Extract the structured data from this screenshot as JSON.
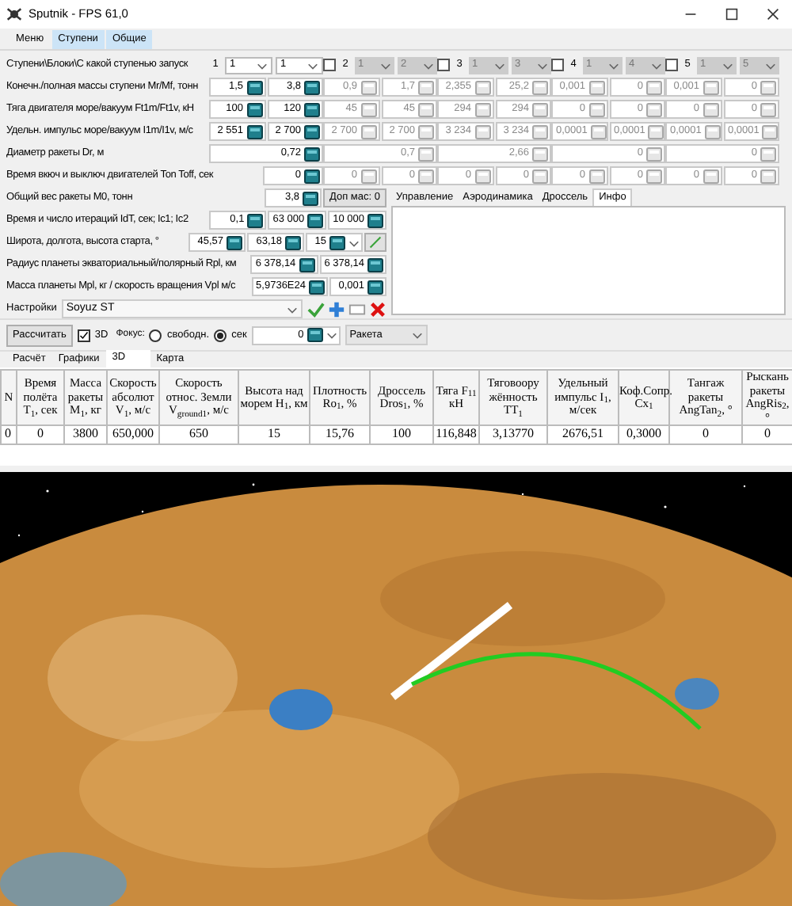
{
  "window": {
    "title": "Sputnik - FPS 61,0"
  },
  "menu": [
    {
      "label": "Меню",
      "selected": false
    },
    {
      "label": "Ступени",
      "selected": true
    },
    {
      "label": "Общие",
      "selected": true
    }
  ],
  "stages": {
    "header_label": "Ступени\\Блоки\\С какой ступенью запуск",
    "columns": [
      {
        "label": "1",
        "enabled": true,
        "select_1": "1",
        "select_2": "1"
      },
      {
        "label": "2",
        "checked": false,
        "enabled": false,
        "select_1": "1",
        "select_2": "2"
      },
      {
        "label": "3",
        "checked": false,
        "enabled": false,
        "select_1": "1",
        "select_2": "3"
      },
      {
        "label": "4",
        "checked": false,
        "enabled": false,
        "select_1": "1",
        "select_2": "4"
      },
      {
        "label": "5",
        "checked": false,
        "enabled": false,
        "select_1": "1",
        "select_2": "5"
      }
    ],
    "rows": [
      {
        "label": "Конечн./полная массы ступени Mr/Mf, тонн",
        "kind": "pair",
        "values": [
          [
            "1,5",
            "3,8"
          ],
          [
            "0,9",
            "1,7"
          ],
          [
            "2,355",
            "25,2"
          ],
          [
            "0,001",
            "0"
          ],
          [
            "0,001",
            "0"
          ]
        ]
      },
      {
        "label": "Тяга двигателя море/вакуум Ft1m/Ft1v, кН",
        "kind": "pair",
        "values": [
          [
            "100",
            "120"
          ],
          [
            "45",
            "45"
          ],
          [
            "294",
            "294"
          ],
          [
            "0",
            "0"
          ],
          [
            "0",
            "0"
          ]
        ]
      },
      {
        "label": "Удельн. импульс море/вакуум I1m/I1v, м/с",
        "kind": "pair",
        "values": [
          [
            "2 551",
            "2 700"
          ],
          [
            "2 700",
            "2 700"
          ],
          [
            "3 234",
            "3 234"
          ],
          [
            "0,0001",
            "0,0001"
          ],
          [
            "0,0001",
            "0,0001"
          ]
        ]
      },
      {
        "label": "Диаметр ракеты Dr, м",
        "kind": "single",
        "values": [
          [
            "0,72"
          ],
          [
            "0,7"
          ],
          [
            "2,66"
          ],
          [
            "0"
          ],
          [
            "0"
          ]
        ]
      },
      {
        "label": "Время вкюч и выключ двигателей Ton Toff, сек",
        "kind": "pair",
        "values": [
          [
            "0"
          ],
          [
            "0",
            "0"
          ],
          [
            "0",
            "0"
          ],
          [
            "0",
            "0"
          ],
          [
            "0",
            "0"
          ]
        ]
      }
    ]
  },
  "general": [
    {
      "label": "Общий вес ракеты M0, тонн",
      "fields": [
        {
          "kind": "spin",
          "value": "3,8"
        },
        {
          "kind": "button",
          "label": "Доп мас: 0"
        }
      ]
    },
    {
      "label": "Время и число итераций IdT, сек; Ic1; Ic2",
      "fields": [
        {
          "kind": "spin",
          "value": "0,1"
        },
        {
          "kind": "spin",
          "value": "63 000"
        },
        {
          "kind": "spin",
          "value": "10 000"
        }
      ]
    },
    {
      "label": "Широта, долгота, высота старта, °",
      "fields": [
        {
          "kind": "spin",
          "value": "45,57"
        },
        {
          "kind": "spin",
          "value": "63,18"
        },
        {
          "kind": "combo",
          "value": "15"
        },
        {
          "kind": "tool"
        }
      ]
    },
    {
      "label": "Радиус планеты экваториальный/полярный Rpl, км",
      "fields": [
        {
          "kind": "spin",
          "value": "6 378,14"
        },
        {
          "kind": "spin",
          "value": "6 378,14"
        }
      ]
    },
    {
      "label": "Масса планеты Mpl, кг / скорость вращения Vpl м/с",
      "fields": [
        {
          "kind": "spin",
          "value": "5,9736E24"
        },
        {
          "kind": "spin",
          "value": "0,001"
        }
      ]
    }
  ],
  "settings": {
    "label": "Настройки",
    "value": "Soyuz ST"
  },
  "side_tabs": [
    {
      "label": "Управление",
      "selected": false
    },
    {
      "label": "Аэродинамика",
      "selected": false
    },
    {
      "label": "Дроссель",
      "selected": false
    },
    {
      "label": "Инфо",
      "selected": true
    }
  ],
  "toolbar": {
    "calculate": "Рассчитать",
    "show_3d": {
      "label": "3D",
      "checked": true
    },
    "focus_label": "Фокус:",
    "focus_options": [
      {
        "label": "свободн.",
        "selected": false
      },
      {
        "label": "сек",
        "selected": true
      }
    ],
    "time_value": "0",
    "object": "Ракета"
  },
  "view_tabs": [
    {
      "label": "Расчёт",
      "selected": false
    },
    {
      "label": "Графики",
      "selected": false
    },
    {
      "label": "3D",
      "selected": true
    },
    {
      "label": "Карта",
      "selected": false
    }
  ],
  "table": {
    "columns": [
      "N",
      "Время полёта T$_{1}$, сек",
      "Масса ракеты M$_{1}$, кг",
      "Скорость абсолют V$_{1}$, м/с",
      "Скорость относ. Земли V$_{ground1}$, м/с",
      "Высота над морем H$_{1}$, км",
      "Плотность Ro$_{1}$, %",
      "Дроссель Dros$_{1}$, %",
      "Тяга F$_{11}$ кН",
      "Тяговоору жённость TT$_{1}$",
      "Удельный импульс I$_{1}$, м/сек",
      "Коф.Сопр. Cx$_{1}$",
      "Тангаж ракеты AngTan$_{2}$, °",
      "Рыскань ракеты AngRis$_{2}$, °"
    ],
    "rows": [
      [
        "0",
        "0",
        "3800",
        "650,000",
        "650",
        "15",
        "15,76",
        "100",
        "116,848",
        "3,13770",
        "2676,51",
        "0,3000",
        "0",
        "0"
      ]
    ]
  }
}
